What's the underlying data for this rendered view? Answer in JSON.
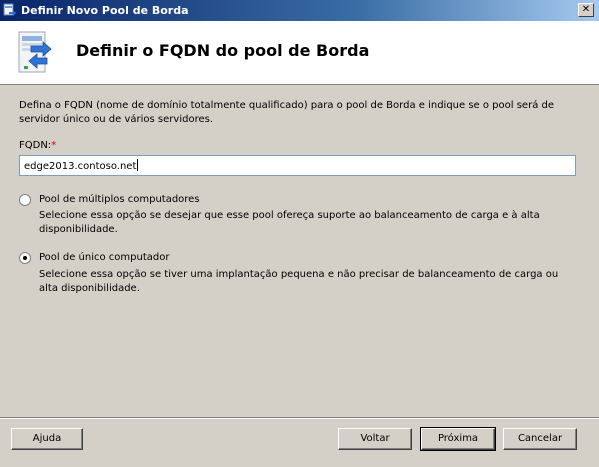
{
  "window": {
    "title": "Definir Novo Pool de Borda",
    "close_glyph": "✕"
  },
  "header": {
    "title": "Definir o FQDN do pool de Borda",
    "icon": "edge-pool-wizard-icon"
  },
  "description": "Defina o FQDN (nome de domínio totalmente qualificado) para o pool de Borda e indique se o pool será de servidor único ou de vários servidores.",
  "fqdn": {
    "label": "FQDN:",
    "required_marker": "*",
    "value": "edge2013.contoso.net"
  },
  "options": [
    {
      "title": "Pool de múltiplos computadores",
      "description": "Selecione essa opção se desejar que esse pool ofereça suporte ao balanceamento de carga e à alta disponibilidade.",
      "selected": false
    },
    {
      "title": "Pool de único computador",
      "description": "Selecione essa opção se tiver uma implantação pequena e não precisar de balanceamento de carga ou alta disponibilidade.",
      "selected": true
    }
  ],
  "buttons": {
    "help": "Ajuda",
    "back": "Voltar",
    "next": "Próxima",
    "cancel": "Cancelar"
  },
  "colors": {
    "titlebar_start": "#0a246a",
    "titlebar_end": "#a6caf0",
    "dialog_bg": "#d4d0c8",
    "required": "#d00000"
  }
}
